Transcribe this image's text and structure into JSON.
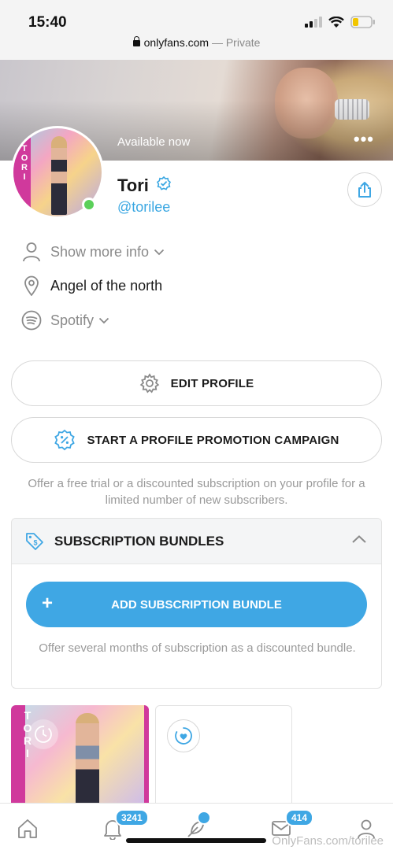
{
  "status_bar": {
    "time": "15:40"
  },
  "browser": {
    "domain": "onlyfans.com",
    "mode": "— Private"
  },
  "cover": {
    "availability": "Available now",
    "more_icon": "more-horizontal-icon"
  },
  "profile": {
    "name": "Tori",
    "handle": "@torilee",
    "online": true,
    "avatar_letters": "TORI"
  },
  "info": {
    "show_more": "Show more info",
    "location": "Angel of the north",
    "spotify": "Spotify"
  },
  "actions": {
    "edit_profile": "EDIT PROFILE",
    "promo_campaign": "START A PROFILE PROMOTION CAMPAIGN",
    "promo_note": "Offer a free trial or a discounted subscription on your profile for a limited number of new subscribers."
  },
  "bundles": {
    "title": "SUBSCRIPTION BUNDLES",
    "add_label": "ADD SUBSCRIPTION BUNDLE",
    "plus": "+",
    "note": "Offer several months of subscription as a discounted bundle."
  },
  "bottom_nav": {
    "notifications_count": "3241",
    "messages_count": "414"
  },
  "watermark": "OnlyFans.com/torilee",
  "colors": {
    "accent": "#3fa7e4",
    "online": "#5bd05a",
    "muted_text": "#9a9a9a"
  }
}
